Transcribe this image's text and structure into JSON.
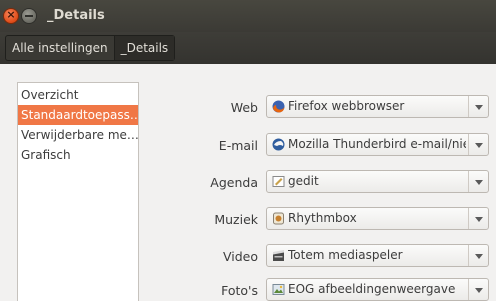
{
  "window": {
    "title": "_Details"
  },
  "breadcrumb": {
    "items": [
      "Alle instellingen",
      "_Details"
    ]
  },
  "sidebar": {
    "items": [
      "Overzicht",
      "Standaardtoepass…",
      "Verwijderbare me…",
      "Grafisch"
    ],
    "selected": 1
  },
  "defaults": {
    "rows": [
      {
        "label": "Web",
        "value": "Firefox webbrowser",
        "icon": "firefox-icon"
      },
      {
        "label": "E-mail",
        "value": "Mozilla Thunderbird e-mail/nieuws",
        "icon": "thunderbird-icon"
      },
      {
        "label": "Agenda",
        "value": "gedit",
        "icon": "gedit-icon"
      },
      {
        "label": "Muziek",
        "value": "Rhythmbox",
        "icon": "rhythmbox-icon"
      },
      {
        "label": "Video",
        "value": "Totem mediaspeler",
        "icon": "totem-icon"
      },
      {
        "label": "Foto's",
        "value": "EOG afbeeldingenweergave",
        "icon": "eog-icon"
      }
    ]
  },
  "colors": {
    "accent": "#f07746",
    "titlebar": "#3b3a35"
  }
}
